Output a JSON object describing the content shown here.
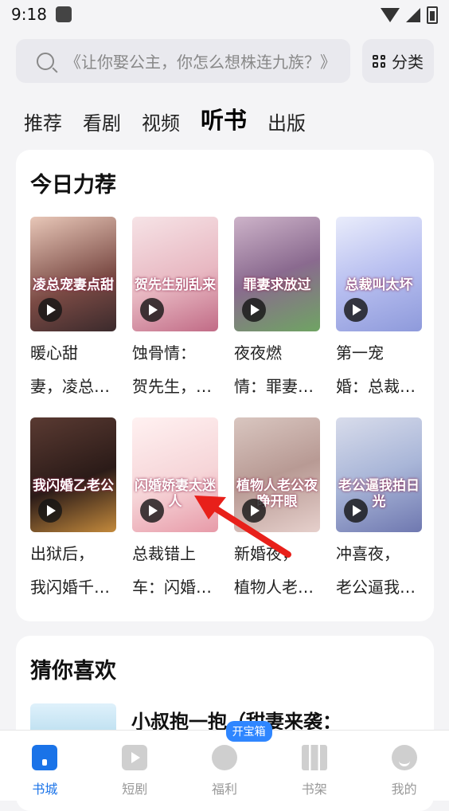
{
  "status": {
    "time": "9:18"
  },
  "search": {
    "placeholder": "《让你娶公主，你怎么想株连九族？》"
  },
  "category_button": {
    "label": "分类",
    "icon": "grid-icon"
  },
  "tabs": [
    {
      "label": "推荐",
      "active": false
    },
    {
      "label": "看剧",
      "active": false
    },
    {
      "label": "视频",
      "active": false
    },
    {
      "label": "听书",
      "active": true
    },
    {
      "label": "出版",
      "active": false
    }
  ],
  "recommend": {
    "heading": "今日力荐",
    "books": [
      {
        "line1": "暖心甜",
        "line2": "妻，凌总…",
        "cover_text": "凌总宠妻点甜"
      },
      {
        "line1": "蚀骨情：",
        "line2": "贺先生，…",
        "cover_text": "贺先生别乱来"
      },
      {
        "line1": "夜夜燃",
        "line2": "情：罪妻…",
        "cover_text": "罪妻求放过"
      },
      {
        "line1": "第一宠",
        "line2": "婚：总裁…",
        "cover_text": "总裁叫太坏"
      },
      {
        "line1": "出狱后，",
        "line2": "我闪婚千…",
        "cover_text": "我闪婚乙老公"
      },
      {
        "line1": "总裁错上",
        "line2": "车：闪婚…",
        "cover_text": "闪婚娇妻太迷人"
      },
      {
        "line1": "新婚夜，",
        "line2": "植物人老…",
        "cover_text": "植物人老公夜睁开眼"
      },
      {
        "line1": "冲喜夜，",
        "line2": "老公逼我…",
        "cover_text": "老公逼我拍日光"
      }
    ]
  },
  "guess": {
    "heading": "猜你喜欢",
    "first_title": "小叔抱一抱（甜妻来袭："
  },
  "nav": {
    "items": [
      {
        "label": "书城",
        "icon": "home-icon",
        "active": true
      },
      {
        "label": "短剧",
        "icon": "play-icon",
        "active": false
      },
      {
        "label": "福利",
        "icon": "gift-icon",
        "active": false,
        "badge": "开宝箱"
      },
      {
        "label": "书架",
        "icon": "bookshelf-icon",
        "active": false
      },
      {
        "label": "我的",
        "icon": "profile-icon",
        "active": false
      }
    ]
  },
  "colors": {
    "accent": "#1a73e8",
    "badge": "#2f86ff",
    "arrow": "#e8201a"
  }
}
